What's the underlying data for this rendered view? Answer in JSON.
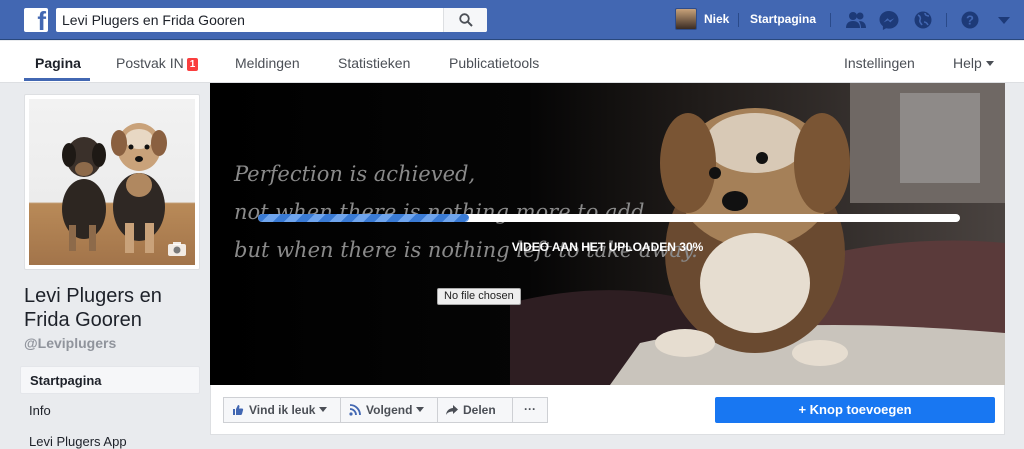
{
  "topbar": {
    "search_value": "Levi Plugers en Frida Gooren",
    "user_name": "Niek",
    "home_label": "Startpagina",
    "icons": [
      "facebook-logo-icon",
      "search-icon",
      "friend-requests-icon",
      "messenger-icon",
      "notifications-globe-icon",
      "help-icon",
      "chevron-down-icon"
    ]
  },
  "pagenav": {
    "tabs": [
      {
        "label": "Pagina"
      },
      {
        "label": "Postvak IN",
        "badge": "1"
      },
      {
        "label": "Meldingen"
      },
      {
        "label": "Statistieken"
      },
      {
        "label": "Publicatietools"
      }
    ],
    "settings": "Instellingen",
    "help": "Help"
  },
  "page": {
    "name": "Levi Plugers en Frida Gooren",
    "handle": "@Leviplugers",
    "left_nav": [
      "Startpagina",
      "Info",
      "Levi Plugers App"
    ]
  },
  "cover": {
    "quote_lines": [
      "Perfection is achieved,",
      "not when there is nothing more to add,",
      "but when there is nothing left to take away."
    ],
    "upload_label": "VIDEO AAN HET UPLOADEN 30%",
    "upload_progress": 0.3,
    "file_button": "No file chosen"
  },
  "actions": {
    "like": "Vind ik leuk",
    "follow": "Volgend",
    "share": "Delen",
    "more": "···",
    "add_button": "+ Knop toevoegen"
  },
  "colors": {
    "brand": "#4267b2",
    "primary_button": "#1877f2",
    "badge": "#fa3e3e",
    "progress": "#3a7bd5"
  }
}
